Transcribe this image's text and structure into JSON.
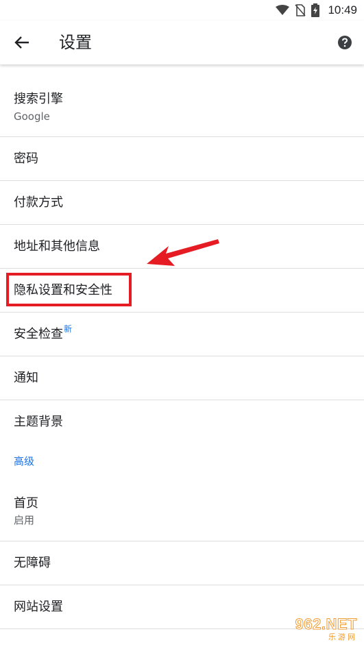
{
  "status_bar": {
    "time": "10:49"
  },
  "app_bar": {
    "title": "设置"
  },
  "settings": {
    "items": [
      {
        "label": "搜索引擎",
        "subtitle": "Google"
      },
      {
        "label": "密码"
      },
      {
        "label": "付款方式"
      },
      {
        "label": "地址和其他信息"
      },
      {
        "label": "隐私设置和安全性"
      },
      {
        "label": "安全检查",
        "badge": "新"
      },
      {
        "label": "通知"
      },
      {
        "label": "主题背景"
      }
    ],
    "advanced_header": "高级",
    "advanced_items": [
      {
        "label": "首页",
        "subtitle": "启用"
      },
      {
        "label": "无障碍"
      },
      {
        "label": "网站设置"
      }
    ]
  },
  "annotation": {
    "highlight_color": "#e51c23"
  },
  "watermark": {
    "main": "962.NET",
    "sub": "乐游网"
  },
  "colors": {
    "accent": "#1a73e8",
    "text_primary": "#202124",
    "text_secondary": "#5f6368",
    "divider": "#dcdcdc"
  }
}
